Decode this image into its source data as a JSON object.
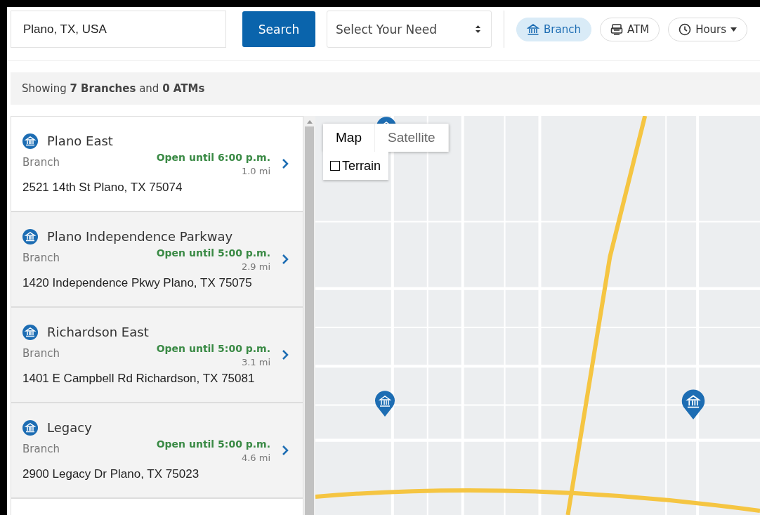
{
  "search": {
    "value": "Plano, TX, USA",
    "button": "Search"
  },
  "need_select": {
    "value": "Select Your Need"
  },
  "filters": [
    {
      "label": "Branch",
      "kind": "branch",
      "selected": true
    },
    {
      "label": "ATM",
      "kind": "atm",
      "selected": false
    },
    {
      "label": "Hours",
      "kind": "hours",
      "selected": false
    }
  ],
  "summary": "Showing **7 Branches** and **0 ATMs**",
  "locations": [
    {
      "name": "Plano East",
      "type": "Branch",
      "hours": "Open until 6:00 p.m.",
      "distance": "1.0 mi",
      "address": "2521 14th St Plano, TX 75074",
      "selected": true
    },
    {
      "name": "Plano Independence Parkway",
      "type": "Branch",
      "hours": "Open until 5:00 p.m.",
      "distance": "2.9 mi",
      "address": "1420 Independence Pkwy Plano, TX 75075",
      "selected": false
    },
    {
      "name": "Richardson East",
      "type": "Branch",
      "hours": "Open until 5:00 p.m.",
      "distance": "3.1 mi",
      "address": "1401 E Campbell Rd Richardson, TX 75081",
      "selected": false
    },
    {
      "name": "Legacy",
      "type": "Branch",
      "hours": "Open until 5:00 p.m.",
      "distance": "4.6 mi",
      "address": "2900 Legacy Dr Plano, TX 75023",
      "selected": false
    }
  ],
  "map": {
    "types": [
      {
        "label": "Map",
        "selected": true
      },
      {
        "label": "Satellite",
        "selected": false
      }
    ],
    "terrain": {
      "label": "Terrain",
      "checked": false
    }
  }
}
